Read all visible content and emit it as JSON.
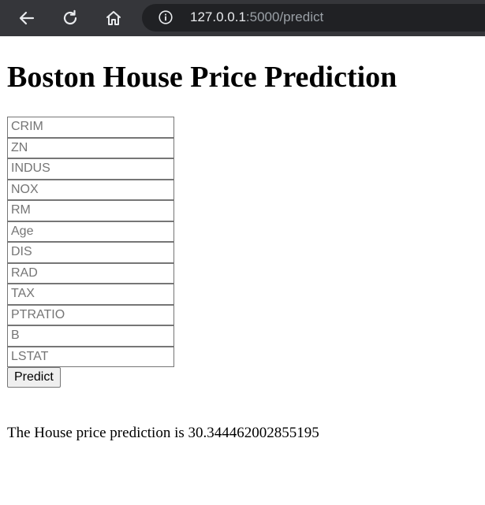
{
  "browser": {
    "url_host": "127.0.0.1",
    "url_path": ":5000/predict",
    "icons": [
      "back-arrow-icon",
      "reload-icon",
      "home-icon",
      "info-icon"
    ]
  },
  "page": {
    "title": "Boston House Price Prediction"
  },
  "form": {
    "fields": [
      {
        "name": "CRIM",
        "placeholder": "CRIM"
      },
      {
        "name": "ZN",
        "placeholder": "ZN"
      },
      {
        "name": "INDUS",
        "placeholder": "INDUS"
      },
      {
        "name": "NOX",
        "placeholder": "NOX"
      },
      {
        "name": "RM",
        "placeholder": "RM"
      },
      {
        "name": "Age",
        "placeholder": "Age"
      },
      {
        "name": "DIS",
        "placeholder": "DIS"
      },
      {
        "name": "RAD",
        "placeholder": "RAD"
      },
      {
        "name": "TAX",
        "placeholder": "TAX"
      },
      {
        "name": "PTRATIO",
        "placeholder": "PTRATIO"
      },
      {
        "name": "B",
        "placeholder": "B"
      },
      {
        "name": "LSTAT",
        "placeholder": "LSTAT"
      }
    ],
    "submit_label": "Predict"
  },
  "result": {
    "text": "The House price prediction is 30.344462002855195"
  },
  "colors": {
    "toolbar": "#35363a",
    "omnibox": "#202124",
    "url_host": "#e8eaed",
    "url_path": "#9aa0a6"
  }
}
